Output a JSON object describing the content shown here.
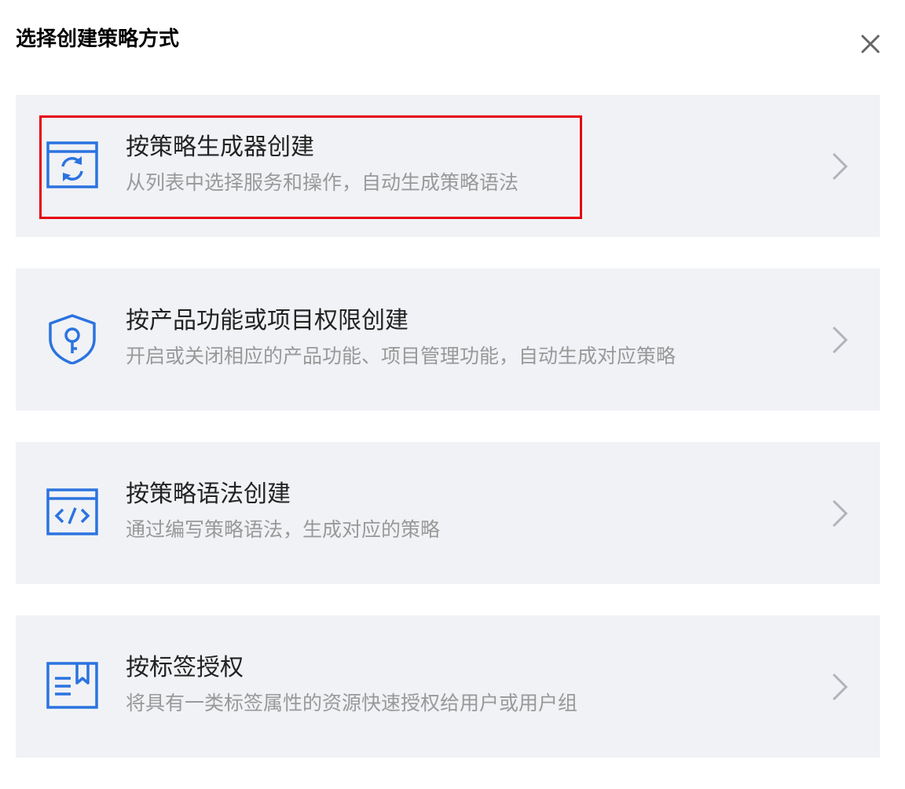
{
  "dialog": {
    "title": "选择创建策略方式",
    "close_icon": "close-icon"
  },
  "options": [
    {
      "title": "按策略生成器创建",
      "description": "从列表中选择服务和操作，自动生成策略语法",
      "icon": "policy-generator-icon",
      "highlighted": true
    },
    {
      "title": "按产品功能或项目权限创建",
      "description": "开启或关闭相应的产品功能、项目管理功能，自动生成对应策略",
      "icon": "shield-key-icon",
      "highlighted": false
    },
    {
      "title": "按策略语法创建",
      "description": "通过编写策略语法，生成对应的策略",
      "icon": "code-window-icon",
      "highlighted": false
    },
    {
      "title": "按标签授权",
      "description": "将具有一类标签属性的资源快速授权给用户或用户组",
      "icon": "tag-document-icon",
      "highlighted": false
    }
  ],
  "colors": {
    "accent_icon": "#2b73e0",
    "card_background": "#f0f2f5",
    "highlight_border": "#e60012",
    "description_text": "#999999"
  }
}
